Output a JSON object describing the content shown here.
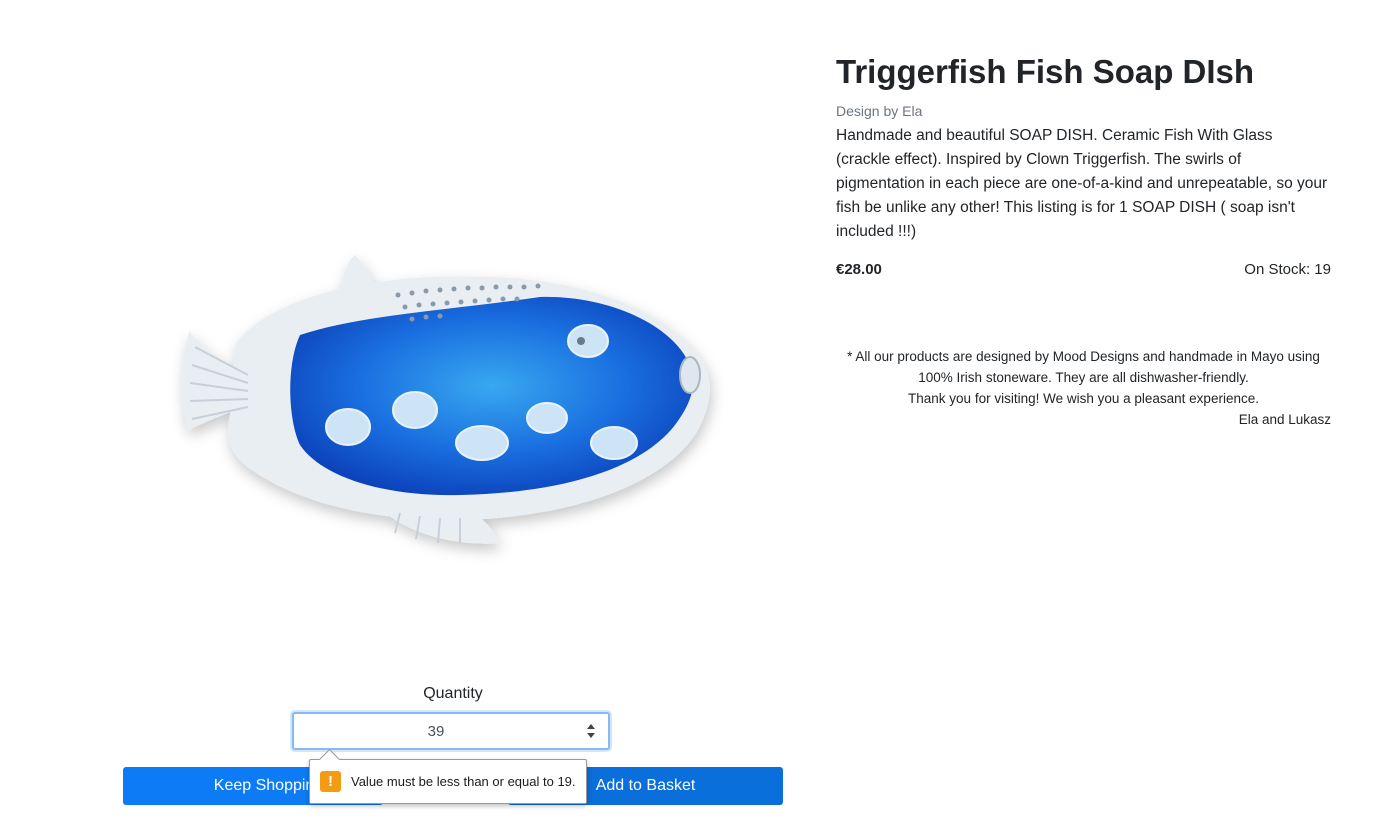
{
  "product": {
    "title": "Triggerfish Fish Soap DIsh",
    "designer": "Design by Ela",
    "description": "Handmade and beautiful SOAP DISH. Ceramic Fish With Glass (crackle effect). Inspired by Clown Triggerfish. The swirls of pigmentation in each piece are one-of-a-kind and unrepeatable, so your fish be unlike any other! This listing is for 1 SOAP DISH ( soap isn't included !!!)",
    "price": "€28.00",
    "stock": "On Stock: 19",
    "image_icon": "fish-soap-dish-image"
  },
  "footnote": {
    "line1": "* All our products are designed by Mood Designs and handmade in Mayo using",
    "line2": "100% Irish stoneware. They are all dishwasher-friendly.",
    "line3": "Thank you for visiting! We wish you a pleasant experience.",
    "signature": "Ela and Lukasz"
  },
  "quantity": {
    "label": "Quantity",
    "value": "39"
  },
  "buttons": {
    "keep_shopping": "Keep Shopping",
    "add_to_basket": "Add to Basket"
  },
  "validation": {
    "message": "Value must be less than or equal to 19.",
    "icon": "warning-icon",
    "color": "#f39c12"
  },
  "colors": {
    "primary": "#0d7bf5",
    "glaze_blue": "#1565d8"
  }
}
